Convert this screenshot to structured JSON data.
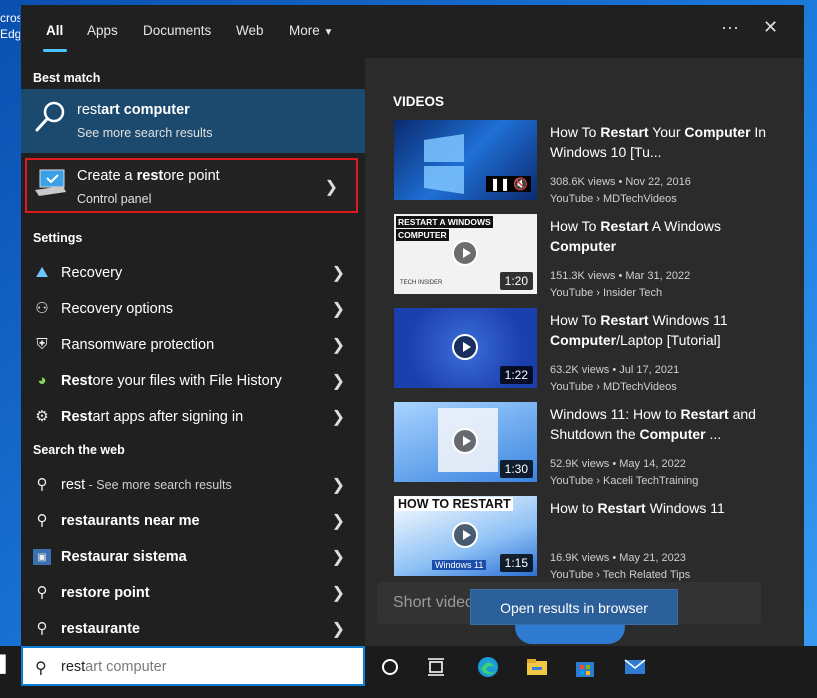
{
  "desktop": {
    "partial_text": "crosEdge"
  },
  "tabs": [
    {
      "label": "All"
    },
    {
      "label": "Apps"
    },
    {
      "label": "Documents"
    },
    {
      "label": "Web"
    },
    {
      "label": "More"
    }
  ],
  "best_match": {
    "header": "Best match",
    "title_prefix": "rest",
    "title_suffix": "art computer",
    "subtitle": "See more search results"
  },
  "restore_point": {
    "title_a": "Create a ",
    "title_b": "rest",
    "title_c": "ore point",
    "subtitle": "Control panel"
  },
  "settings": {
    "header": "Settings",
    "items": [
      {
        "label": "Recovery",
        "icon": "recovery-icon"
      },
      {
        "label": "Recovery options",
        "icon": "person-icon"
      },
      {
        "label": "Ransomware protection",
        "icon": "shield-icon"
      },
      {
        "label_bold": "Rest",
        "label_rest": "ore your files with File History",
        "icon": "file-history-icon"
      },
      {
        "label_bold": "Rest",
        "label_rest": "art apps after signing in",
        "icon": "gear-search-icon"
      }
    ]
  },
  "web": {
    "header": "Search the web",
    "items": [
      {
        "label": "rest",
        "sub": " - See more search results"
      },
      {
        "label": "restaurants near me"
      },
      {
        "label": "Restaurar sistema"
      },
      {
        "label": "restore point"
      },
      {
        "label": "restaurante"
      }
    ]
  },
  "videos": {
    "header": "VIDEOS",
    "items": [
      {
        "t_a": "How To ",
        "t_b": "Restart",
        "t_c": " Your ",
        "t_d": "Computer",
        "t_e": " In Windows 10 [Tu...",
        "meta1": "308.6K views • Nov 22, 2016",
        "meta2": "YouTube › MDTechVideos",
        "duration": ""
      },
      {
        "t_a": "How To ",
        "t_b": "Restart",
        "t_c": " A Windows ",
        "t_d": "Computer",
        "t_e": "",
        "meta1": "151.3K views • Mar 31, 2022",
        "meta2": "YouTube › Insider Tech",
        "duration": "1:20"
      },
      {
        "t_a": "How To ",
        "t_b": "Restart",
        "t_c": " Windows 11 ",
        "t_d": "Computer",
        "t_e": "/Laptop [Tutorial]",
        "meta1": "63.2K views • Jul 17, 2021",
        "meta2": "YouTube › MDTechVideos",
        "duration": "1:22"
      },
      {
        "t_a": "Windows 11: How to ",
        "t_b": "Restart",
        "t_c": " and Shutdown the ",
        "t_d": "Computer",
        "t_e": " ...",
        "meta1": "52.9K views • May 14, 2022",
        "meta2": "YouTube › Kaceli TechTraining",
        "duration": "1:30"
      },
      {
        "t_a": "How to ",
        "t_b": "Restart",
        "t_c": " Windows 11",
        "t_d": "",
        "t_e": "",
        "meta1": "16.9K views • May 21, 2023",
        "meta2": "YouTube › Tech Related Tips",
        "duration": "1:15"
      }
    ],
    "thumb_texts": {
      "t2a": "RESTART A WINDOWS",
      "t2b": "COMPUTER",
      "t2c": "TECH INSIDER",
      "t5a": "HOW TO RESTART",
      "t5b": "Windows 11"
    }
  },
  "short_videos": "Short videos",
  "tooltip": "Open results in browser",
  "search": {
    "typed": "rest",
    "hint": "art computer"
  }
}
